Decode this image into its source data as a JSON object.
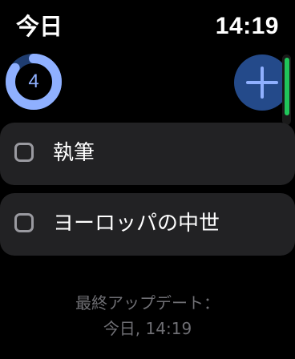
{
  "header": {
    "title": "今日",
    "time": "14:19"
  },
  "progress": {
    "count": "4",
    "fraction": 0.85,
    "track_color": "#1f3d70",
    "fill_color": "#8fb0ff"
  },
  "add_button": {
    "icon": "plus-icon",
    "color": "#244a8a"
  },
  "scroll_indicator": {
    "color": "#20c55a"
  },
  "tasks": [
    {
      "label": "執筆",
      "checked": false
    },
    {
      "label": "ヨーロッパの中世",
      "checked": false
    }
  ],
  "footer": {
    "updated_label": "最終アップデート：",
    "updated_value": "今日, 14:19"
  }
}
